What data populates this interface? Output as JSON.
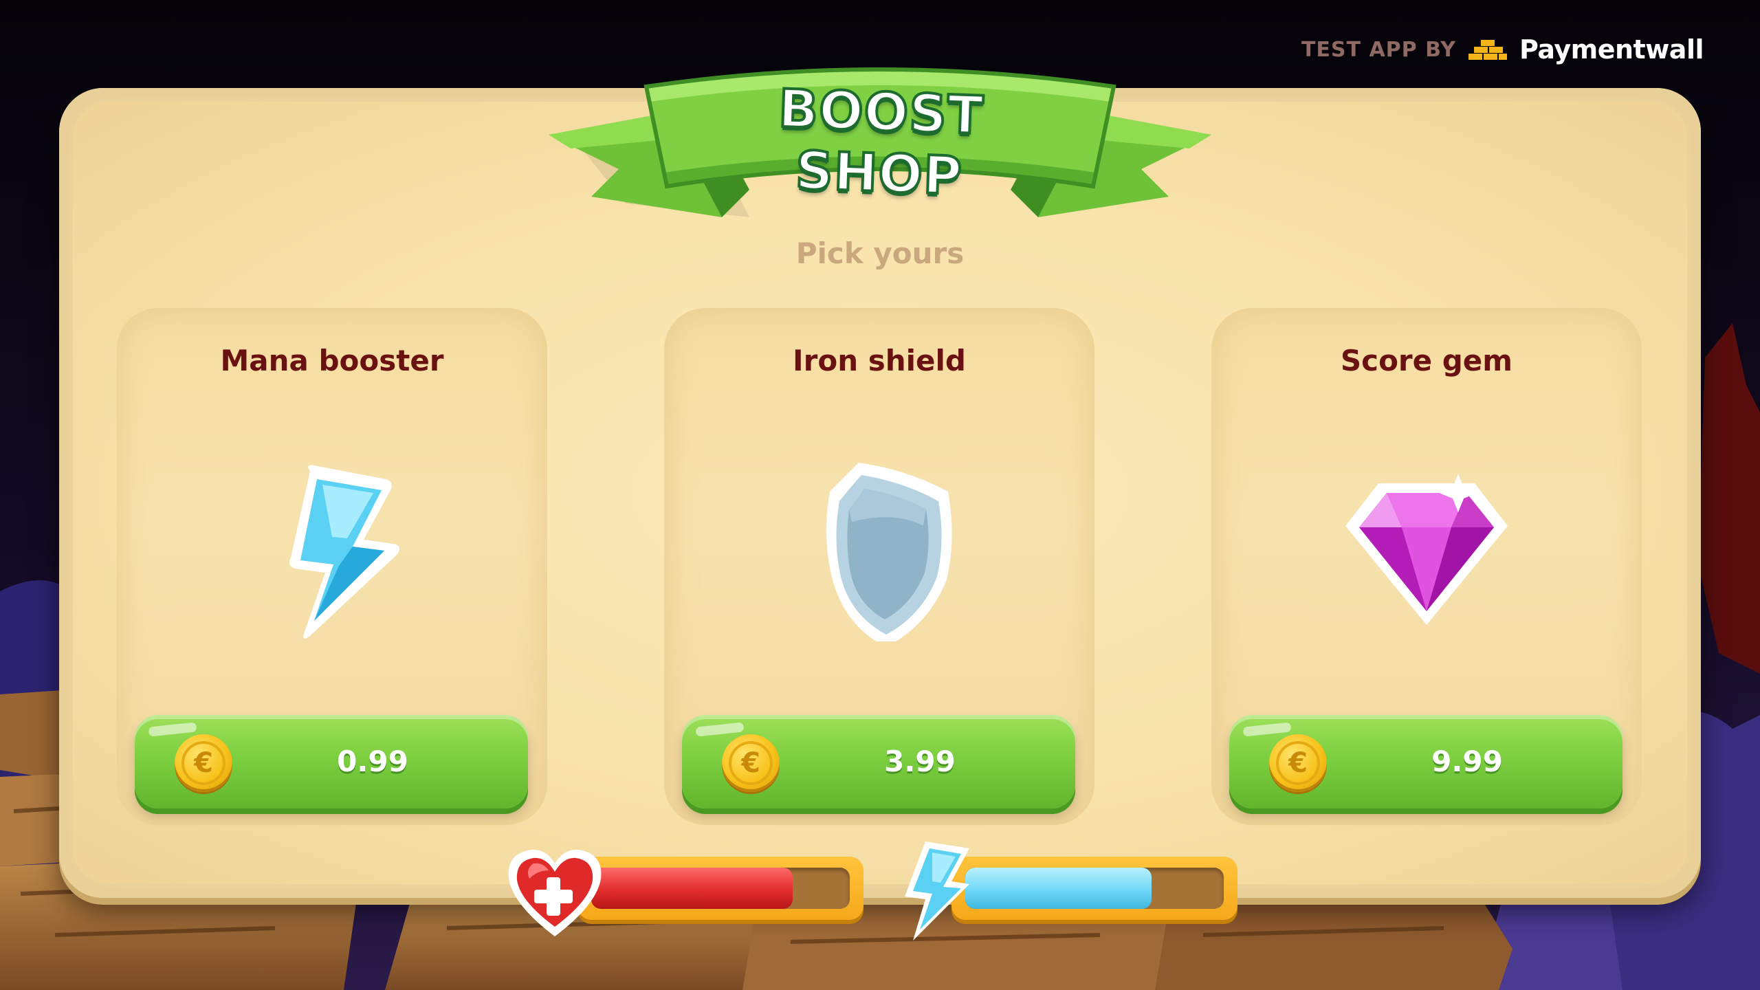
{
  "branding": {
    "tag": "TEST APP BY",
    "company": "Paymentwall",
    "logo_icon": "paymentwall-logo-icon"
  },
  "shop": {
    "title": "BOOST SHOP",
    "subtitle": "Pick yours",
    "items": [
      {
        "name": "Mana booster",
        "icon": "lightning-bolt-icon",
        "price": "0.99",
        "currency_icon": "euro-coin-icon"
      },
      {
        "name": "Iron shield",
        "icon": "shield-icon",
        "price": "3.99",
        "currency_icon": "euro-coin-icon"
      },
      {
        "name": "Score gem",
        "icon": "diamond-gem-icon",
        "price": "9.99",
        "currency_icon": "euro-coin-icon"
      }
    ],
    "currency_symbol": "€"
  },
  "status": {
    "health": {
      "icon": "heart-plus-icon",
      "fill_fraction": 0.78
    },
    "mana": {
      "icon": "lightning-bolt-icon",
      "fill_fraction": 0.72
    }
  },
  "colors": {
    "panel": "#f3e2b0",
    "button_green": "#7ccf3f",
    "title_text": "#6a1212",
    "ribbon_green": "#7fd043",
    "health_red": "#e12c2c",
    "mana_blue": "#6fd7f6",
    "coin_gold": "#f7c21a"
  }
}
